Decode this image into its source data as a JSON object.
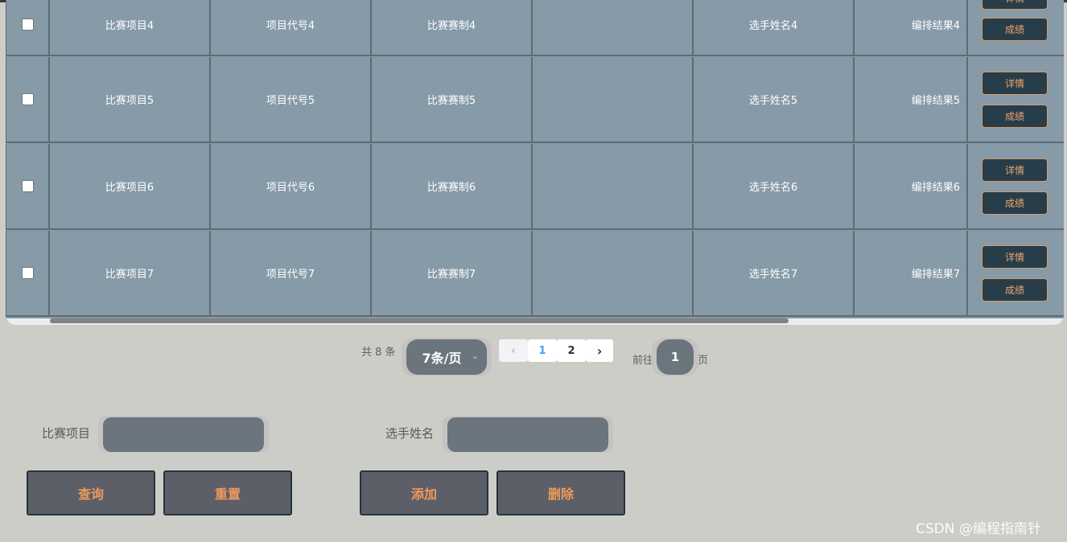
{
  "table": {
    "rows": [
      {
        "project": "比赛项目4",
        "code": "项目代号4",
        "format": "比赛赛制4",
        "blank": "",
        "player": "选手姓名4",
        "result": "编排结果4"
      },
      {
        "project": "比赛项目5",
        "code": "项目代号5",
        "format": "比赛赛制5",
        "blank": "",
        "player": "选手姓名5",
        "result": "编排结果5"
      },
      {
        "project": "比赛项目6",
        "code": "项目代号6",
        "format": "比赛赛制6",
        "blank": "",
        "player": "选手姓名6",
        "result": "编排结果6"
      },
      {
        "project": "比赛项目7",
        "code": "项目代号7",
        "format": "比赛赛制7",
        "blank": "",
        "player": "选手姓名7",
        "result": "编排结果7"
      }
    ],
    "detail_label": "详情",
    "score_label": "成绩"
  },
  "pagination": {
    "total_text": "共 8 条",
    "page_size": "7条/页",
    "pages": [
      "1",
      "2"
    ],
    "goto_prefix": "前往",
    "goto_value": "1",
    "goto_suffix": "页"
  },
  "search": {
    "project_label": "比赛项目",
    "player_label": "选手姓名"
  },
  "actions": {
    "query": "查询",
    "reset": "重置",
    "add": "添加",
    "delete": "删除"
  },
  "watermark": "CSDN @编程指南针",
  "colors": {
    "table_bg": "#869aa7",
    "button_dark": "#273e4a",
    "accent_orange": "#ef9a5a",
    "page_bg": "#cdcdc8"
  }
}
